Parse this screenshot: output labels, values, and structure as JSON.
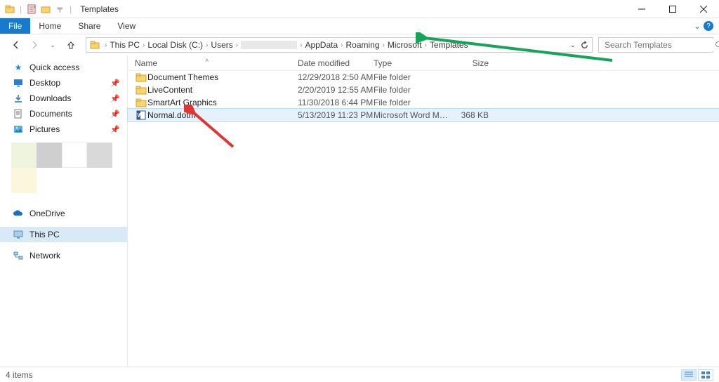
{
  "window": {
    "title": "Templates"
  },
  "ribbon": {
    "file": "File",
    "home": "Home",
    "share": "Share",
    "view": "View"
  },
  "breadcrumbs": [
    {
      "label": "This PC"
    },
    {
      "label": "Local Disk (C:)"
    },
    {
      "label": "Users"
    },
    {
      "label": "",
      "blank": true
    },
    {
      "label": "AppData"
    },
    {
      "label": "Roaming"
    },
    {
      "label": "Microsoft"
    },
    {
      "label": "Templates"
    }
  ],
  "search": {
    "placeholder": "Search Templates"
  },
  "sidebar": {
    "quick_access": "Quick access",
    "desktop": "Desktop",
    "downloads": "Downloads",
    "documents": "Documents",
    "pictures": "Pictures",
    "onedrive": "OneDrive",
    "this_pc": "This PC",
    "network": "Network"
  },
  "columns": {
    "name": "Name",
    "date": "Date modified",
    "type": "Type",
    "size": "Size"
  },
  "rows": [
    {
      "icon": "folder",
      "name": "Document Themes",
      "date": "12/29/2018 2:50 AM",
      "type": "File folder",
      "size": ""
    },
    {
      "icon": "folder",
      "name": "LiveContent",
      "date": "2/20/2019 12:55 AM",
      "type": "File folder",
      "size": ""
    },
    {
      "icon": "folder",
      "name": "SmartArt Graphics",
      "date": "11/30/2018 6:44 PM",
      "type": "File folder",
      "size": ""
    },
    {
      "icon": "word",
      "name": "Normal.dotm",
      "date": "5/13/2019 11:23 PM",
      "type": "Microsoft Word Macr...",
      "size": "368 KB",
      "selected": true
    }
  ],
  "status": {
    "count": "4 items"
  }
}
